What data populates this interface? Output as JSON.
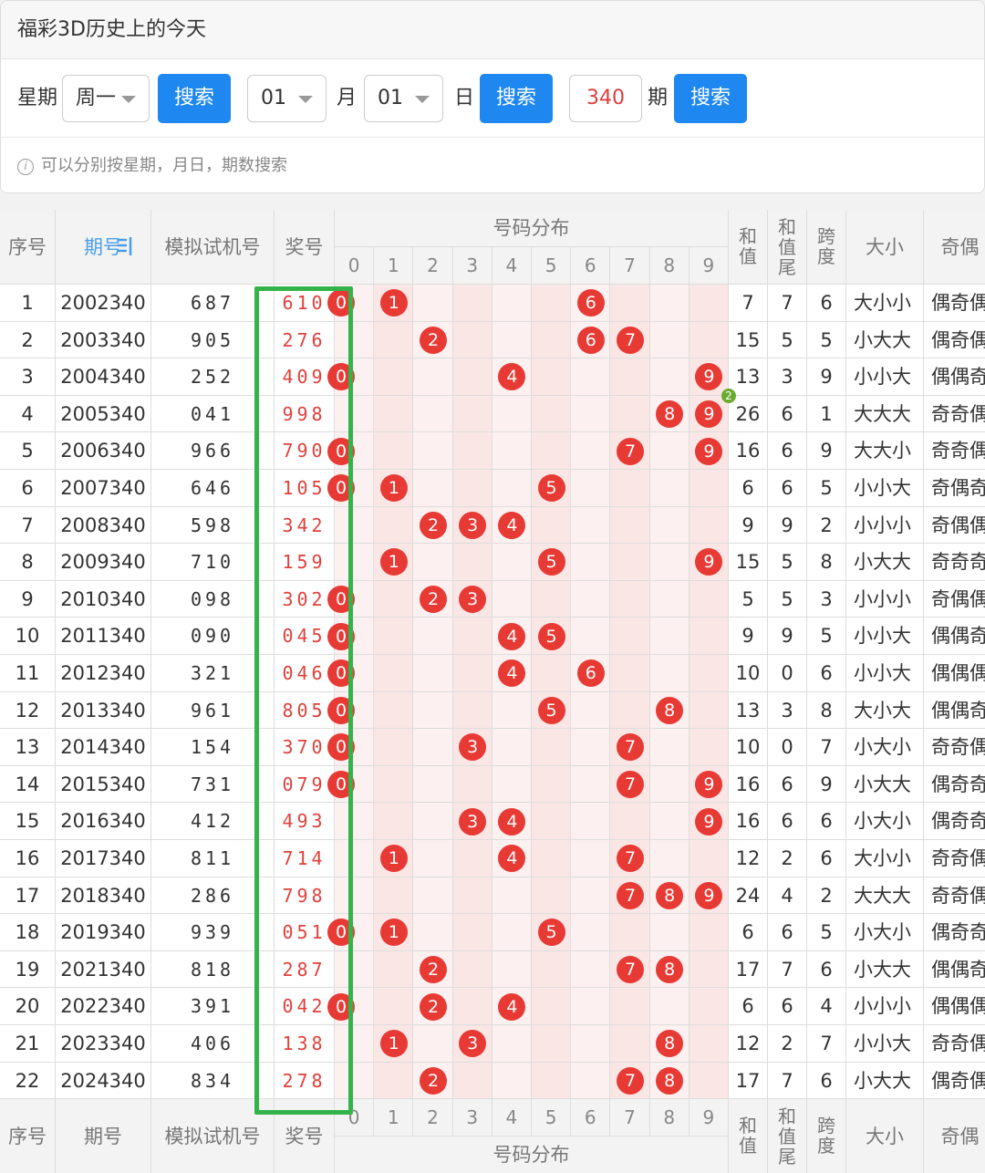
{
  "panel": {
    "title": "福彩3D历史上的今天",
    "weekday_label": "星期",
    "weekday_value": "周一",
    "search_label": "搜索",
    "month_value": "01",
    "month_label": "月",
    "day_value": "01",
    "day_label": "日",
    "period_value": "340",
    "period_label": "期",
    "hint": "可以分别按星期，月日，期数搜索"
  },
  "table": {
    "headers": {
      "seq": "序号",
      "period": "期号",
      "sim": "模拟试机号",
      "prize": "奖号",
      "distribution": "号码分布",
      "sum": "和值",
      "sum_tail": "和值尾",
      "span": "跨度",
      "size": "大小",
      "parity": "奇偶"
    },
    "digits": [
      "0",
      "1",
      "2",
      "3",
      "4",
      "5",
      "6",
      "7",
      "8",
      "9"
    ],
    "badge_row": 4,
    "badge_value": "2",
    "rows": [
      {
        "seq": "1",
        "period": "2002340",
        "sim": "687",
        "prize": "610",
        "sum": "7",
        "tail": "7",
        "span": "6",
        "size": "大小小",
        "parity": "偶奇偶"
      },
      {
        "seq": "2",
        "period": "2003340",
        "sim": "905",
        "prize": "276",
        "sum": "15",
        "tail": "5",
        "span": "5",
        "size": "小大大",
        "parity": "偶奇偶"
      },
      {
        "seq": "3",
        "period": "2004340",
        "sim": "252",
        "prize": "409",
        "sum": "13",
        "tail": "3",
        "span": "9",
        "size": "小小大",
        "parity": "偶偶奇"
      },
      {
        "seq": "4",
        "period": "2005340",
        "sim": "041",
        "prize": "998",
        "sum": "26",
        "tail": "6",
        "span": "1",
        "size": "大大大",
        "parity": "奇奇偶"
      },
      {
        "seq": "5",
        "period": "2006340",
        "sim": "966",
        "prize": "790",
        "sum": "16",
        "tail": "6",
        "span": "9",
        "size": "大大小",
        "parity": "奇奇偶"
      },
      {
        "seq": "6",
        "period": "2007340",
        "sim": "646",
        "prize": "105",
        "sum": "6",
        "tail": "6",
        "span": "5",
        "size": "小小大",
        "parity": "奇偶奇"
      },
      {
        "seq": "7",
        "period": "2008340",
        "sim": "598",
        "prize": "342",
        "sum": "9",
        "tail": "9",
        "span": "2",
        "size": "小小小",
        "parity": "奇偶偶"
      },
      {
        "seq": "8",
        "period": "2009340",
        "sim": "710",
        "prize": "159",
        "sum": "15",
        "tail": "5",
        "span": "8",
        "size": "小大大",
        "parity": "奇奇奇"
      },
      {
        "seq": "9",
        "period": "2010340",
        "sim": "098",
        "prize": "302",
        "sum": "5",
        "tail": "5",
        "span": "3",
        "size": "小小小",
        "parity": "奇偶偶"
      },
      {
        "seq": "10",
        "period": "2011340",
        "sim": "090",
        "prize": "045",
        "sum": "9",
        "tail": "9",
        "span": "5",
        "size": "小小大",
        "parity": "偶偶奇"
      },
      {
        "seq": "11",
        "period": "2012340",
        "sim": "321",
        "prize": "046",
        "sum": "10",
        "tail": "0",
        "span": "6",
        "size": "小小大",
        "parity": "偶偶偶"
      },
      {
        "seq": "12",
        "period": "2013340",
        "sim": "961",
        "prize": "805",
        "sum": "13",
        "tail": "3",
        "span": "8",
        "size": "大小大",
        "parity": "偶偶奇"
      },
      {
        "seq": "13",
        "period": "2014340",
        "sim": "154",
        "prize": "370",
        "sum": "10",
        "tail": "0",
        "span": "7",
        "size": "小大小",
        "parity": "奇奇偶"
      },
      {
        "seq": "14",
        "period": "2015340",
        "sim": "731",
        "prize": "079",
        "sum": "16",
        "tail": "6",
        "span": "9",
        "size": "小大大",
        "parity": "偶奇奇"
      },
      {
        "seq": "15",
        "period": "2016340",
        "sim": "412",
        "prize": "493",
        "sum": "16",
        "tail": "6",
        "span": "6",
        "size": "小大小",
        "parity": "偶奇奇"
      },
      {
        "seq": "16",
        "period": "2017340",
        "sim": "811",
        "prize": "714",
        "sum": "12",
        "tail": "2",
        "span": "6",
        "size": "大小小",
        "parity": "奇奇偶"
      },
      {
        "seq": "17",
        "period": "2018340",
        "sim": "286",
        "prize": "798",
        "sum": "24",
        "tail": "4",
        "span": "2",
        "size": "大大大",
        "parity": "奇奇偶"
      },
      {
        "seq": "18",
        "period": "2019340",
        "sim": "939",
        "prize": "051",
        "sum": "6",
        "tail": "6",
        "span": "5",
        "size": "小大小",
        "parity": "偶奇奇"
      },
      {
        "seq": "19",
        "period": "2021340",
        "sim": "818",
        "prize": "287",
        "sum": "17",
        "tail": "7",
        "span": "6",
        "size": "小大大",
        "parity": "偶偶奇"
      },
      {
        "seq": "20",
        "period": "2022340",
        "sim": "391",
        "prize": "042",
        "sum": "6",
        "tail": "6",
        "span": "4",
        "size": "小小小",
        "parity": "偶偶偶"
      },
      {
        "seq": "21",
        "period": "2023340",
        "sim": "406",
        "prize": "138",
        "sum": "12",
        "tail": "2",
        "span": "7",
        "size": "小小大",
        "parity": "奇奇偶"
      },
      {
        "seq": "22",
        "period": "2024340",
        "sim": "834",
        "prize": "278",
        "sum": "17",
        "tail": "7",
        "span": "6",
        "size": "小大大",
        "parity": "偶奇偶"
      }
    ]
  }
}
